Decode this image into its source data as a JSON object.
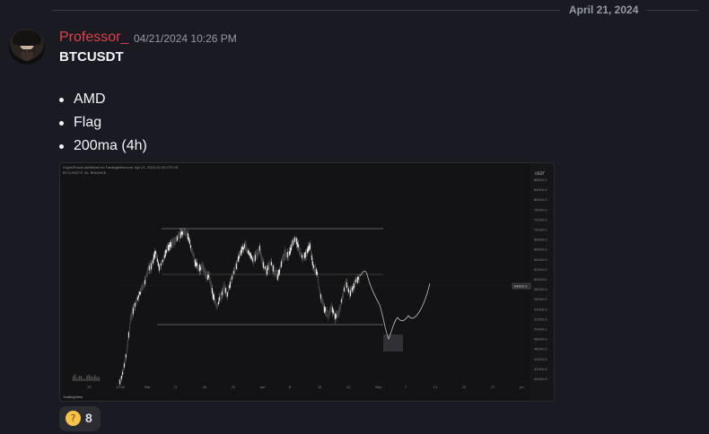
{
  "date_divider": "April 21, 2024",
  "message": {
    "author": "Professor_",
    "author_color": "#e0404a",
    "timestamp": "04/21/2024 10:26 PM",
    "title": "BTCUSDT",
    "bullets": [
      "AMD",
      "Flag",
      "200ma (4h)"
    ],
    "reaction": {
      "icon": "thinking-face-icon",
      "count": "8"
    }
  },
  "attachment": {
    "header": "CryptoFocus published on TradingView.com, Apr 21, 2024 22:25 UTC+8",
    "symbol": "BTCUSDT.P, 4h, BINANCE",
    "currency": "USDT",
    "branding": "TradingView",
    "price_labels": [
      "88000.0",
      "84000.0",
      "80000.0",
      "76000.0",
      "72000.0",
      "70000.0",
      "68000.0",
      "66000.0",
      "64000.0",
      "62000.0",
      "60000.0",
      "58000.0",
      "56000.0",
      "54000.0",
      "52000.0",
      "50000.0",
      "48000.0",
      "46000.0",
      "44000.0",
      "42000.0",
      "40000.0"
    ],
    "last_price": "64820.0",
    "time_labels": [
      "15",
      "12:00",
      "Mar",
      "11",
      "18",
      "25",
      "Apr",
      "8",
      "15",
      "22",
      "May",
      "7",
      "13",
      "20",
      "27",
      "Jun"
    ],
    "up_color": "#e8e8e8",
    "down_color": "#7a7a7a"
  }
}
